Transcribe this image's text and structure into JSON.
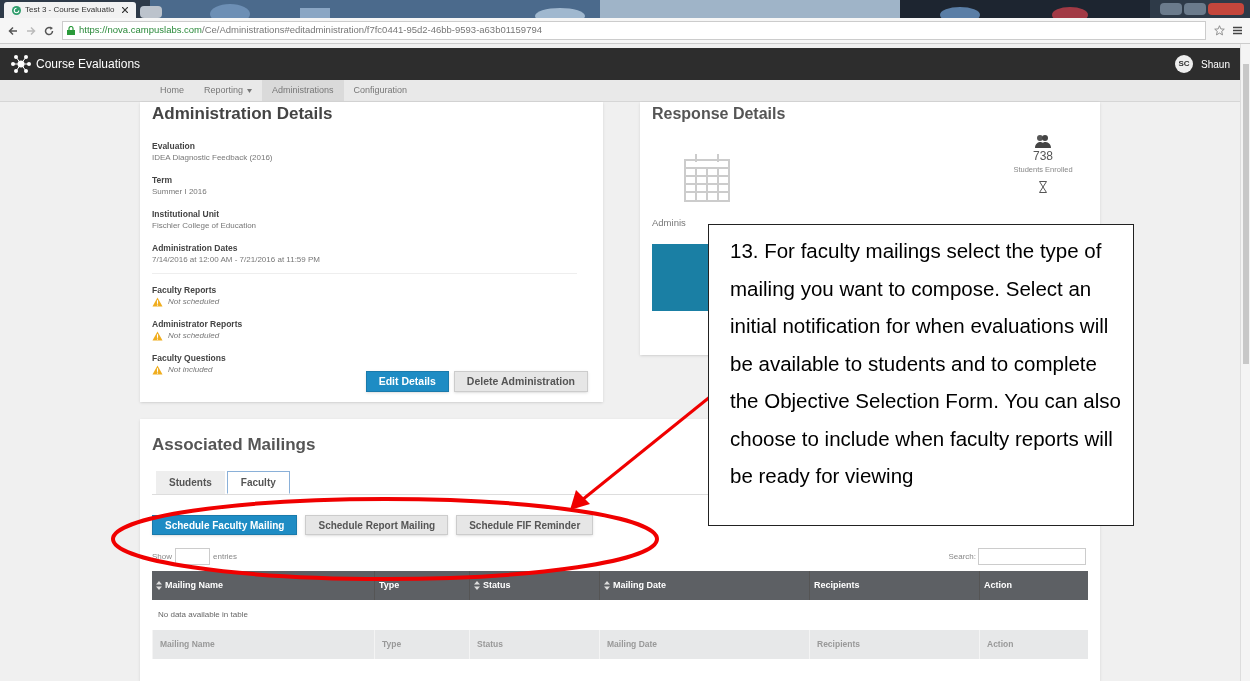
{
  "browser": {
    "tab_title": "Test 3 - Course Evaluatio",
    "url_host": "https://nova.campuslabs.com",
    "url_path": "/Ce/Administrations#editadministration/f7fc0441-95d2-46bb-9593-a63b01159794"
  },
  "app": {
    "title": "Course Evaluations",
    "user_initials": "SC",
    "user_name": "Shaun"
  },
  "nav": [
    {
      "label": "Home",
      "selected": false,
      "dropdown": false
    },
    {
      "label": "Reporting",
      "selected": false,
      "dropdown": true
    },
    {
      "label": "Administrations",
      "selected": true,
      "dropdown": false
    },
    {
      "label": "Configuration",
      "selected": false,
      "dropdown": false
    }
  ],
  "administration_details": {
    "title": "Administration Details",
    "fields": [
      {
        "label": "Evaluation",
        "value": "IDEA Diagnostic Feedback (2016)"
      },
      {
        "label": "Term",
        "value": "Summer I 2016"
      },
      {
        "label": "Institutional Unit",
        "value": "Fischler College of Education"
      },
      {
        "label": "Administration Dates",
        "value": "7/14/2016 at 12:00 AM - 7/21/2016 at 11:59 PM"
      }
    ],
    "statuses": [
      {
        "label": "Faculty Reports",
        "value": "Not scheduled",
        "warning": true
      },
      {
        "label": "Administrator Reports",
        "value": "Not scheduled",
        "warning": true
      },
      {
        "label": "Faculty Questions",
        "value": "Not included",
        "warning": true
      }
    ],
    "buttons": [
      {
        "label": "Edit Details",
        "primary": true
      },
      {
        "label": "Delete Administration",
        "primary": false
      }
    ]
  },
  "response_details": {
    "title": "Response Details",
    "date_label": "Adminis",
    "enrolled_count": "738",
    "enrolled_label": "Students Enrolled"
  },
  "associated_mailings": {
    "title": "Associated Mailings",
    "tabs": [
      {
        "label": "Students",
        "selected": false
      },
      {
        "label": "Faculty",
        "selected": true
      }
    ],
    "buttons": [
      {
        "label": "Schedule Faculty Mailing",
        "primary": true
      },
      {
        "label": "Schedule Report Mailing",
        "primary": false
      },
      {
        "label": "Schedule FIF Reminder",
        "primary": false
      }
    ],
    "show_label": "Show",
    "entries_label": "entries",
    "search_label": "Search:",
    "columns": [
      {
        "label": "Mailing Name",
        "sortable": true
      },
      {
        "label": "Type",
        "sortable": false
      },
      {
        "label": "Status",
        "sortable": true
      },
      {
        "label": "Mailing Date",
        "sortable": true
      },
      {
        "label": "Recipients",
        "sortable": false
      },
      {
        "label": "Action",
        "sortable": false
      }
    ],
    "empty_message": "No data available in table",
    "footer_columns": [
      "Mailing Name",
      "Type",
      "Status",
      "Mailing Date",
      "Recipients",
      "Action"
    ]
  },
  "callout": {
    "text": "13. For faculty mailings select the type of mailing you want to compose. Select an initial notification for when evaluations will be available to students and to complete the Objective Selection Form. You can also choose to include when faculty reports will be ready for viewing"
  }
}
